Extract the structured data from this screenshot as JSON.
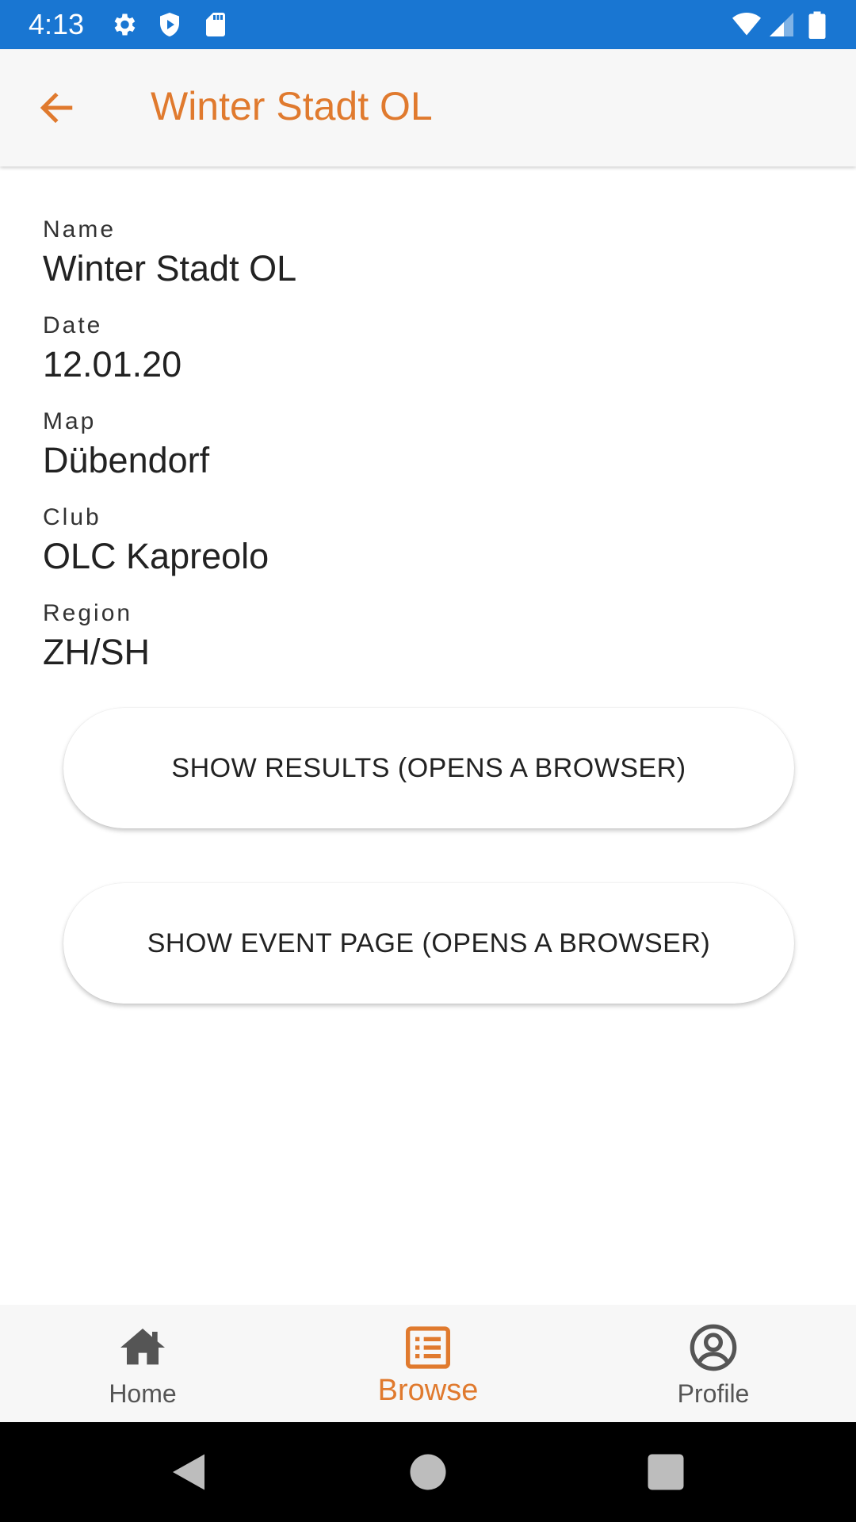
{
  "status_bar": {
    "time": "4:13",
    "left_icons": [
      "settings-icon",
      "shield-icon",
      "sd-card-icon"
    ],
    "right_icons": [
      "wifi-icon",
      "cell-signal-icon",
      "battery-icon"
    ],
    "background": "#1976D2"
  },
  "app_bar": {
    "back_icon": "arrow-back-icon",
    "title": "Winter Stadt OL",
    "accent": "#E07A2E"
  },
  "details": {
    "fields": [
      {
        "label": "Name",
        "value": "Winter Stadt OL"
      },
      {
        "label": "Date",
        "value": "12.01.20"
      },
      {
        "label": "Map",
        "value": "Dübendorf"
      },
      {
        "label": "Club",
        "value": "OLC Kapreolo"
      },
      {
        "label": "Region",
        "value": "ZH/SH"
      }
    ]
  },
  "actions": {
    "results_label": "SHOW RESULTS (OPENS A BROWSER)",
    "event_page_label": "SHOW EVENT PAGE (OPENS A BROWSER)"
  },
  "bottom_nav": {
    "items": [
      {
        "label": "Home",
        "icon": "home-icon",
        "active": false
      },
      {
        "label": "Browse",
        "icon": "list-icon",
        "active": true
      },
      {
        "label": "Profile",
        "icon": "profile-icon",
        "active": false
      }
    ],
    "active_color": "#E07A2E"
  },
  "system_nav": {
    "buttons": [
      "back-triangle-icon",
      "home-circle-icon",
      "recents-square-icon"
    ]
  }
}
